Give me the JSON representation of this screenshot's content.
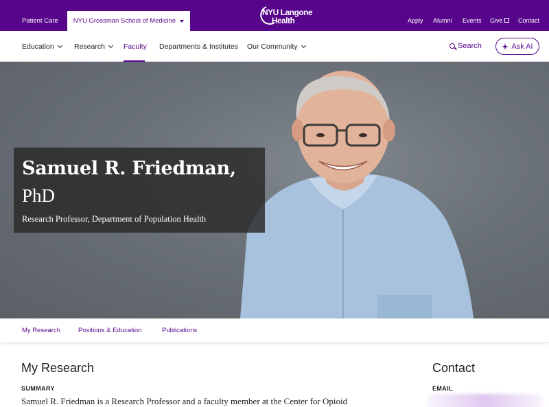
{
  "topbar": {
    "patient_care": "Patient Care",
    "school_selector": "NYU Grossman School of Medicine",
    "logo_line1": "NYU Langone",
    "logo_line2": "Health",
    "links": [
      "Apply",
      "Alumni",
      "Events",
      "Give",
      "Contact"
    ]
  },
  "nav": {
    "items": [
      "Education",
      "Research",
      "Faculty",
      "Departments & Institutes",
      "Our Community"
    ],
    "active": "Faculty",
    "search_label": "Search",
    "ask_ai_label": "Ask AI"
  },
  "hero": {
    "name_line1": "Samuel R. Friedman,",
    "name_line2": "PhD",
    "title": "Research Professor, Department of Population Health"
  },
  "subtabs": [
    "My Research",
    "Positions & Education",
    "Publications"
  ],
  "research": {
    "heading": "My Research",
    "summary_label": "SUMMARY",
    "summary_text": "Samuel R. Friedman is a Research Professor and a faculty member at the Center for Opioid"
  },
  "contact": {
    "heading": "Contact",
    "email_label": "EMAIL"
  },
  "colors": {
    "brand": "#57068c",
    "hero_bg": "#6a7077"
  }
}
